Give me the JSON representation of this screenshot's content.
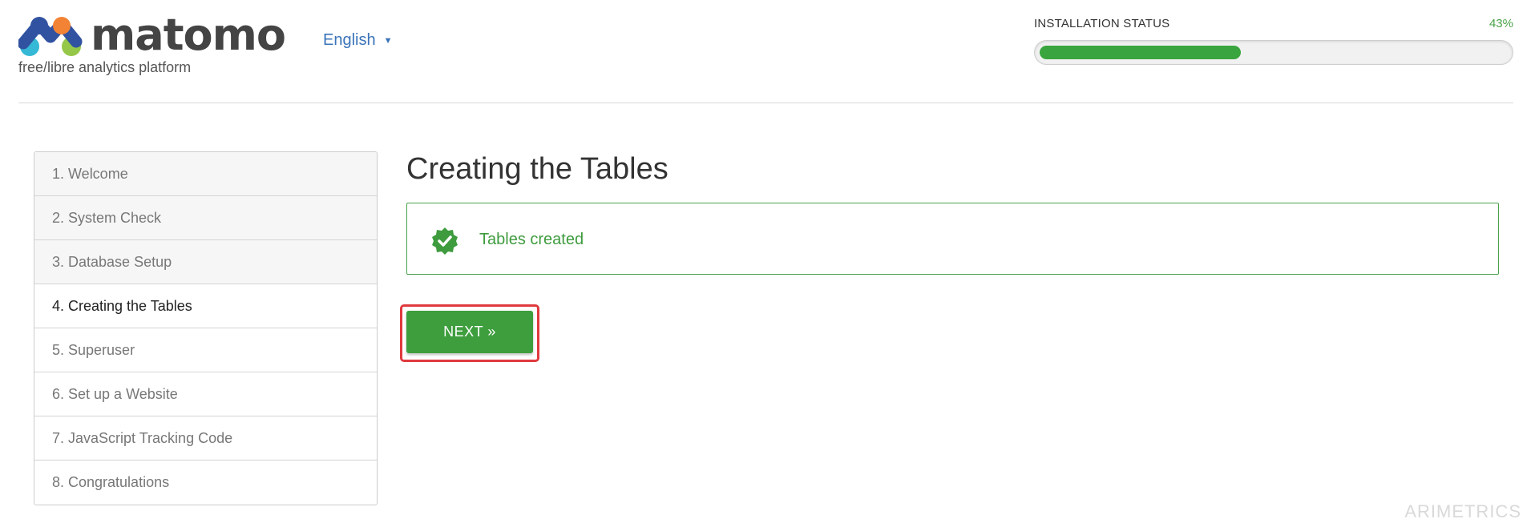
{
  "header": {
    "logo_text": "matomo",
    "tagline": "free/libre analytics platform",
    "language": "English",
    "installation_status_label": "INSTALLATION STATUS",
    "installation_percent_text": "43%",
    "installation_progress": 0.43
  },
  "steps": [
    {
      "label": "1. Welcome",
      "state": "done"
    },
    {
      "label": "2. System Check",
      "state": "done"
    },
    {
      "label": "3. Database Setup",
      "state": "done"
    },
    {
      "label": "4. Creating the Tables",
      "state": "current"
    },
    {
      "label": "5. Superuser",
      "state": "todo"
    },
    {
      "label": "6. Set up a Website",
      "state": "todo"
    },
    {
      "label": "7. JavaScript Tracking Code",
      "state": "todo"
    },
    {
      "label": "8. Congratulations",
      "state": "todo"
    }
  ],
  "main": {
    "title": "Creating the Tables",
    "success_message": "Tables created",
    "next_label": "NEXT »"
  },
  "watermark": "ARIMETRICS",
  "colors": {
    "accent_green": "#3e9e3e",
    "link_blue": "#3a73b8",
    "highlight_red": "#e0393e"
  }
}
